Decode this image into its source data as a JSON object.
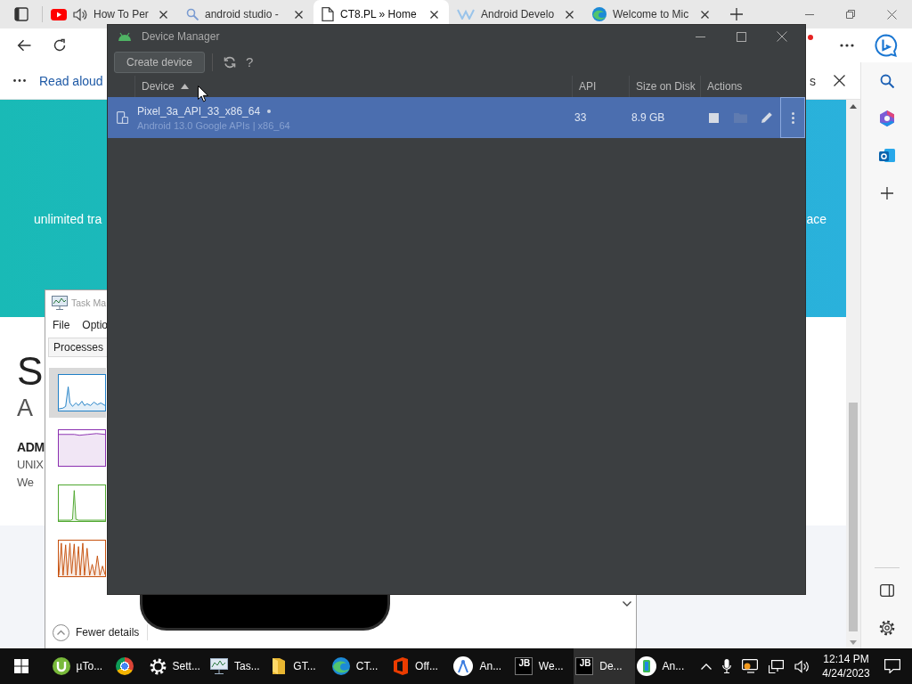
{
  "browser": {
    "tabs": [
      {
        "kind": "video",
        "label": "How To Per",
        "audio_playing": true,
        "selected": false
      },
      {
        "kind": "search",
        "label": "android studio -",
        "audio_playing": false,
        "selected": false
      },
      {
        "kind": "page",
        "label": "CT8.PL » Home",
        "audio_playing": false,
        "selected": true
      },
      {
        "kind": "zigzag",
        "label": "Android Develo",
        "audio_playing": false,
        "selected": false
      },
      {
        "kind": "swirl",
        "label": "Welcome to Mic",
        "audio_playing": false,
        "selected": false
      }
    ],
    "read_aloud": {
      "label": "Read aloud",
      "right_text": "s"
    },
    "page": {
      "banner_left": "unlimited tra",
      "banner_right": "ace",
      "heading": "S",
      "subheading": "A",
      "bold_line": "ADM",
      "lines": [
        "UNIX",
        "We"
      ]
    }
  },
  "task_manager": {
    "title": "Task Ma",
    "menu": [
      "File",
      "Optio"
    ],
    "tabs": [
      {
        "label": "Processes",
        "selected": true
      }
    ],
    "graphs": [
      {
        "kind": "cpu",
        "color": "#1f7fc6",
        "selected": true
      },
      {
        "kind": "memory",
        "color": "#8b2fb0",
        "selected": false
      },
      {
        "kind": "disk",
        "color": "#4ea72e",
        "selected": false
      },
      {
        "kind": "network",
        "color": "#c6500d",
        "selected": false
      }
    ],
    "footer": "Fewer details"
  },
  "device_manager": {
    "title": "Device Manager",
    "create_button": "Create device",
    "help_button": "?",
    "columns": [
      {
        "label": "Device",
        "sorted": true
      },
      {
        "label": "API",
        "sorted": false
      },
      {
        "label": "Size on Disk",
        "sorted": false
      },
      {
        "label": "Actions",
        "sorted": false
      }
    ],
    "devices": [
      {
        "name": "Pixel_3a_API_33_x86_64",
        "online": true,
        "details": "Android 13.0 Google APIs | x86_64",
        "api": "33",
        "size": "8.9 GB",
        "selected": true,
        "menu_focused": true
      }
    ]
  },
  "taskbar": {
    "apps": [
      {
        "kind": "torrent",
        "label": "µTo...",
        "selected": false
      },
      {
        "kind": "chrome",
        "selected": false
      },
      {
        "kind": "settings",
        "label": "Sett...",
        "selected": false
      },
      {
        "kind": "taskmgr",
        "label": "Tas...",
        "selected": false
      },
      {
        "kind": "folder",
        "label": "GT...",
        "selected": false
      },
      {
        "kind": "edge",
        "label": "CT...",
        "selected": false
      },
      {
        "kind": "office",
        "label": "Off...",
        "selected": false
      },
      {
        "kind": "studio",
        "label": "An...",
        "selected": false
      },
      {
        "kind": "jetbrains",
        "badge": "JB",
        "label": "We...",
        "selected": false
      },
      {
        "kind": "jetbrains",
        "badge": "JB",
        "label": "De...",
        "selected": true
      },
      {
        "kind": "phone",
        "label": "An...",
        "selected": false
      }
    ],
    "time": "12:14 PM",
    "date": "4/24/2023"
  }
}
